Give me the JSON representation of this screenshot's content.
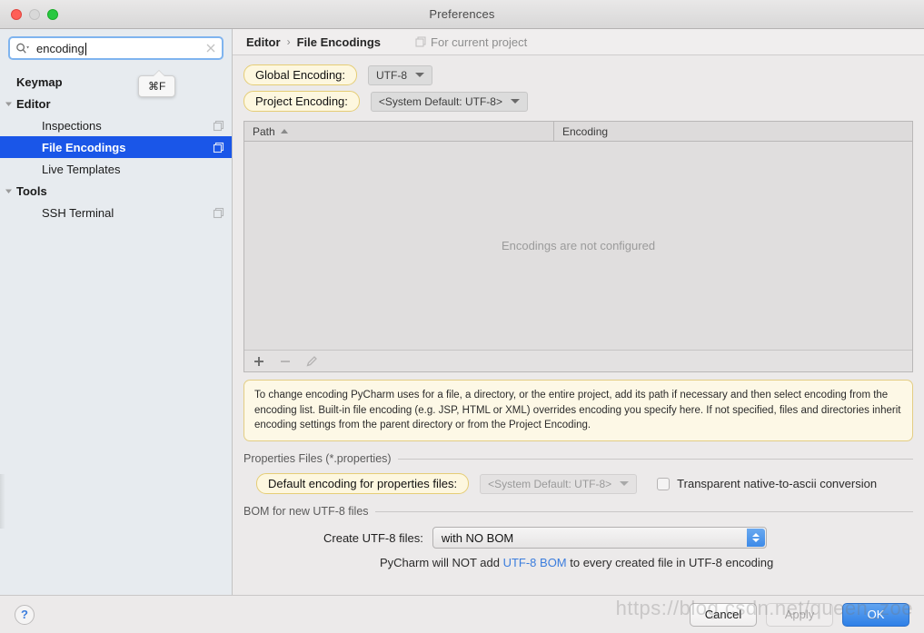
{
  "window": {
    "title": "Preferences",
    "traffic_lights": [
      "close",
      "minimize",
      "zoom"
    ]
  },
  "sidebar": {
    "search": {
      "value": "encoding",
      "placeholder": "",
      "search_icon": "search-icon",
      "clear_icon": "clear-icon"
    },
    "tooltip": {
      "text": "⌘F"
    },
    "items": [
      {
        "label": "Keymap",
        "level": 0,
        "bold": true,
        "twisty": "none",
        "selected": false,
        "copy_icon": false
      },
      {
        "label": "Editor",
        "level": 0,
        "bold": true,
        "twisty": "expanded",
        "selected": false,
        "copy_icon": false
      },
      {
        "label": "Inspections",
        "level": 1,
        "bold": false,
        "twisty": "none",
        "selected": false,
        "copy_icon": true
      },
      {
        "label": "File Encodings",
        "level": 1,
        "bold": true,
        "twisty": "none",
        "selected": true,
        "copy_icon": true
      },
      {
        "label": "Live Templates",
        "level": 1,
        "bold": false,
        "twisty": "none",
        "selected": false,
        "copy_icon": false
      },
      {
        "label": "Tools",
        "level": 0,
        "bold": true,
        "twisty": "expanded",
        "selected": false,
        "copy_icon": false
      },
      {
        "label": "SSH Terminal",
        "level": 1,
        "bold": false,
        "twisty": "none",
        "selected": false,
        "copy_icon": true
      }
    ]
  },
  "breadcrumb": {
    "parent": "Editor",
    "separator": "›",
    "current": "File Encodings",
    "scope_label": "For current project",
    "scope_icon": "project-scope-icon"
  },
  "encodings": {
    "global": {
      "label": "Global Encoding:",
      "value": "UTF-8",
      "disabled": false
    },
    "project": {
      "label": "Project Encoding:",
      "value": "<System Default: UTF-8>",
      "disabled": false
    }
  },
  "table": {
    "columns": [
      "Path",
      "Encoding"
    ],
    "sort_column": "Path",
    "sort_direction": "asc",
    "rows": [],
    "empty_text": "Encodings are not configured",
    "toolbar": {
      "add_label": "+",
      "remove_label": "−",
      "edit_label": "edit"
    }
  },
  "note": {
    "text": "To change encoding PyCharm uses for a file, a directory, or the entire project, add its path if necessary and then select encoding from the encoding list. Built-in file encoding (e.g. JSP, HTML or XML) overrides encoding you specify here. If not specified, files and directories inherit encoding settings from the parent directory or from the Project Encoding."
  },
  "properties_section": {
    "title": "Properties Files (*.properties)",
    "default_encoding_label": "Default encoding for properties files:",
    "default_encoding_value": "<System Default: UTF-8>",
    "default_encoding_disabled": true,
    "transparent_checkbox_label": "Transparent native-to-ascii conversion",
    "transparent_checkbox_checked": false
  },
  "bom_section": {
    "title": "BOM for new UTF-8 files",
    "create_label": "Create UTF-8 files:",
    "create_value": "with NO BOM",
    "note_prefix": "PyCharm will NOT add ",
    "note_link": "UTF-8 BOM",
    "note_suffix": " to every created file in UTF-8 encoding"
  },
  "footer": {
    "help_label": "?",
    "cancel_label": "Cancel",
    "apply_label": "Apply",
    "apply_disabled": true,
    "ok_label": "OK"
  },
  "watermark": {
    "text": "https://blog.csdn.net/queen_zoe"
  },
  "colors": {
    "selection_blue": "#1a56e8",
    "primary_button": "#2f80e7",
    "highlight_yellow": "#fdf7df",
    "highlight_border": "#e5cd76",
    "link_blue": "#3b7ddd"
  }
}
